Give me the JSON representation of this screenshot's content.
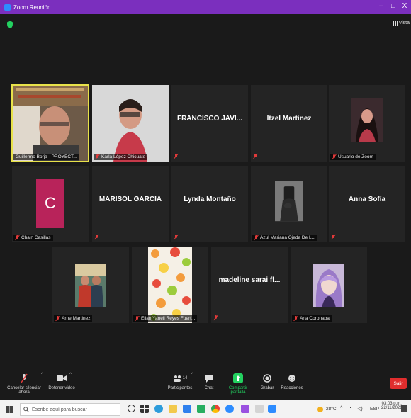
{
  "window": {
    "title": "Zoom Reunión",
    "controls": {
      "minimize": "–",
      "maximize": "□",
      "close": "X"
    }
  },
  "meeting": {
    "view_label": "Vista",
    "participants": [
      {
        "name": "Guillermo Borja - PROYECT...",
        "display": "video",
        "active": true
      },
      {
        "name": "Karla López Chicuate",
        "display": "video"
      },
      {
        "name": "",
        "display": "name",
        "big_name": "FRANCISCO JAVI..."
      },
      {
        "name": "",
        "display": "name",
        "big_name": "Itzel Martinez"
      },
      {
        "name": "Usuario de Zoom",
        "display": "avatar"
      },
      {
        "name": "Chain Casillas",
        "display": "letter",
        "letter": "C"
      },
      {
        "name": "",
        "display": "name",
        "big_name": "MARISOL GARCIA"
      },
      {
        "name": "",
        "display": "name",
        "big_name": "Lynda Montaño"
      },
      {
        "name": "Azul Mariana Ojeda De L...",
        "display": "avatar"
      },
      {
        "name": "",
        "display": "name",
        "big_name": "Anna Sofía"
      },
      {
        "name": "Arne Martinez",
        "display": "avatar"
      },
      {
        "name": "Elian Yaneli Reyes Fuert...",
        "display": "image"
      },
      {
        "name": "",
        "display": "name",
        "big_name": "madeline sarai fl..."
      },
      {
        "name": "Ana Coronaba",
        "display": "avatar"
      }
    ]
  },
  "toolbar": {
    "mute_label": "Cancelar silenciar ahora",
    "video_label": "Detener video",
    "participants_label": "Participantes",
    "participants_count": "14",
    "chat_label": "Chat",
    "share_label": "Compartir pantalla",
    "record_label": "Grabar",
    "reactions_label": "Reacciones",
    "leave_label": "Salir"
  },
  "taskbar": {
    "search_placeholder": "Escribe aquí para buscar",
    "weather": "28°C",
    "language": "ESP",
    "time": "03:03 p.m.",
    "date": "22/11/2021"
  },
  "colors": {
    "titlebar": "#7b2fbe",
    "active_speaker": "#e8e24a",
    "leave": "#e02d2d",
    "share": "#23d160",
    "letter_avatar": "#b8235a"
  }
}
